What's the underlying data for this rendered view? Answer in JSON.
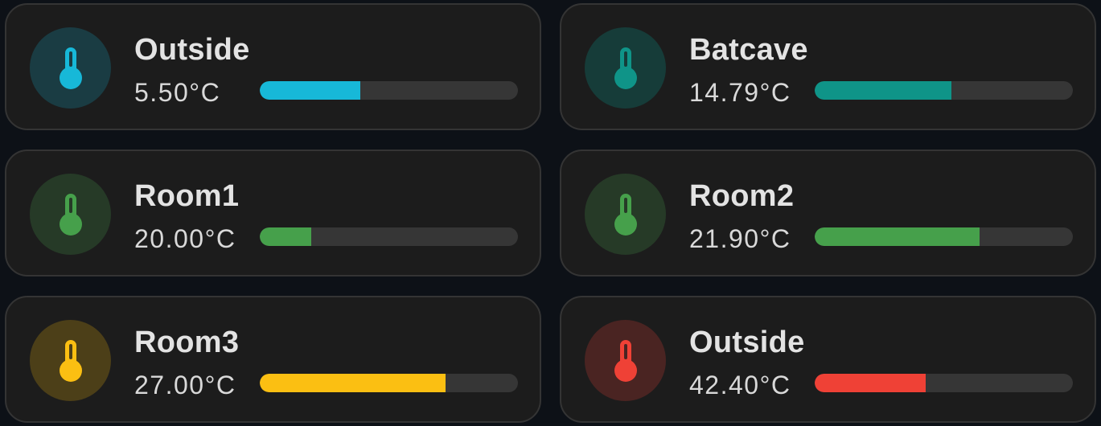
{
  "sensors": [
    {
      "name": "Outside",
      "value": "5.50°C",
      "fill": 0.39,
      "color": "#17b8d8",
      "icon_bg": "#1a3c43",
      "icon": "thermometer-icon"
    },
    {
      "name": "Batcave",
      "value": "14.79°C",
      "fill": 0.53,
      "color": "#0f9488",
      "icon_bg": "#163c39",
      "icon": "thermometer-icon"
    },
    {
      "name": "Room1",
      "value": "20.00°C",
      "fill": 0.2,
      "color": "#46a04b",
      "icon_bg": "#263a27",
      "icon": "thermometer-icon"
    },
    {
      "name": "Room2",
      "value": "21.90°C",
      "fill": 0.64,
      "color": "#46a04b",
      "icon_bg": "#263a27",
      "icon": "thermometer-icon"
    },
    {
      "name": "Room3",
      "value": "27.00°C",
      "fill": 0.72,
      "color": "#fbbf12",
      "icon_bg": "#4c3f18",
      "icon": "thermometer-icon"
    },
    {
      "name": "Outside",
      "value": "42.40°C",
      "fill": 0.43,
      "color": "#ef4136",
      "icon_bg": "#4a2422",
      "icon": "thermometer-icon"
    }
  ]
}
